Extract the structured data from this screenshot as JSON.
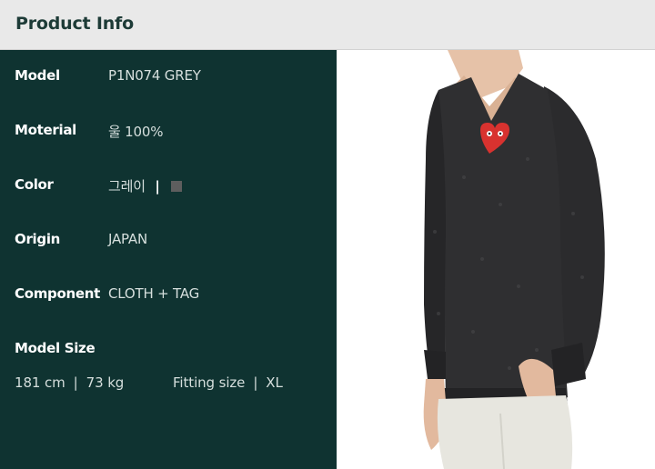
{
  "header": {
    "title": "Product Info"
  },
  "info": {
    "model": {
      "label": "Model",
      "value": "P1N074 GREY"
    },
    "material": {
      "label": "Moterial",
      "value": "울 100%"
    },
    "color": {
      "label": "Color",
      "value": "그레이",
      "separator": "|",
      "swatch_color": "#5e5e5e"
    },
    "origin": {
      "label": "Origin",
      "value": "JAPAN"
    },
    "component": {
      "label": "Component",
      "value": "CLOTH + TAG"
    }
  },
  "model_size": {
    "label": "Model Size",
    "height": "181 cm",
    "weight": "73 kg",
    "fitting_label": "Fitting size",
    "fitting_value": "XL",
    "separator": "|"
  },
  "photo": {
    "icon": "sweater-model-photo",
    "garment_color": "#2f2f31",
    "logo_color": "#d8322f"
  }
}
